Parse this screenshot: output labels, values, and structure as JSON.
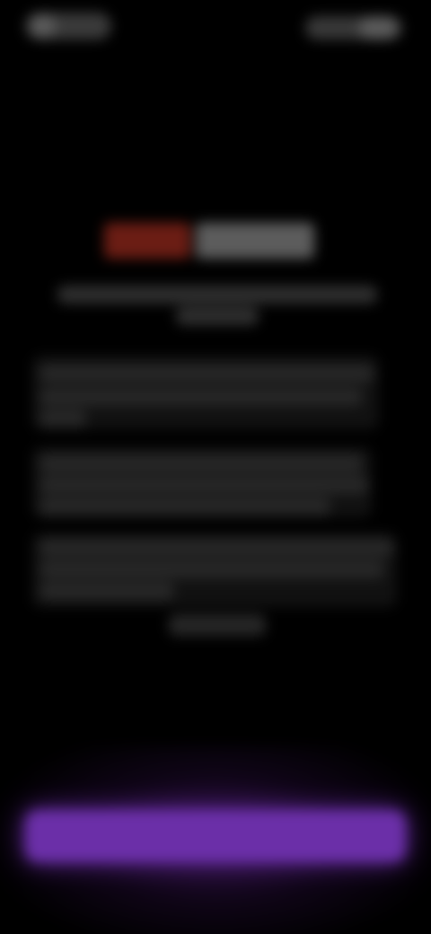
{
  "colors": {
    "background": "#000000",
    "accent_purple": "#6b2fa8",
    "logo_red": "#6b1d14"
  },
  "icons": {
    "status_left": "time-indicator-icon",
    "status_right": "battery-icon"
  },
  "cta": {
    "label": ""
  }
}
